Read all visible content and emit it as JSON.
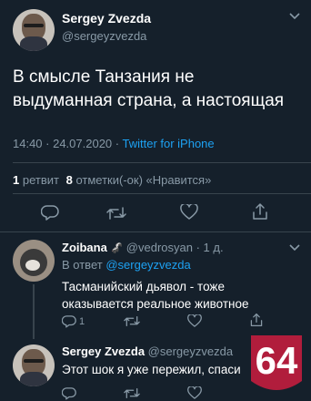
{
  "main_tweet": {
    "display_name": "Sergey Zvezda",
    "handle": "@sergeyzvezda",
    "text_line1": "В смысле Танзания не",
    "text_line2": "выдуманная страна, а настоящая",
    "time": "14:40 · 24.07.2020 ·",
    "source": "Twitter for iPhone",
    "retweets_count": "1",
    "retweets_label": "ретвит",
    "likes_count": "8",
    "likes_label": "отметки(-ок) «Нравится»"
  },
  "reply1": {
    "display_name": "Zoibana",
    "emoji": "🦨",
    "handle_time": "@vedrosyan · 1 д.",
    "reply_prefix": "В ответ",
    "reply_to": "@sergeyzvezda",
    "text_line1": "Тасманийский дьявол - тоже",
    "text_line2": "оказывается реальное животное",
    "reply_count": "1"
  },
  "reply2": {
    "display_name": "Sergey Zvezda",
    "handle": "@sergeyzvezda",
    "text": "Этот шок я уже пережил, спаси"
  },
  "watermark": {
    "text": "64",
    "bg": "#b11d3c"
  },
  "colors": {
    "bg": "#15202b",
    "link": "#1da1f2",
    "muted": "#8899a6",
    "divider": "#38444d"
  }
}
